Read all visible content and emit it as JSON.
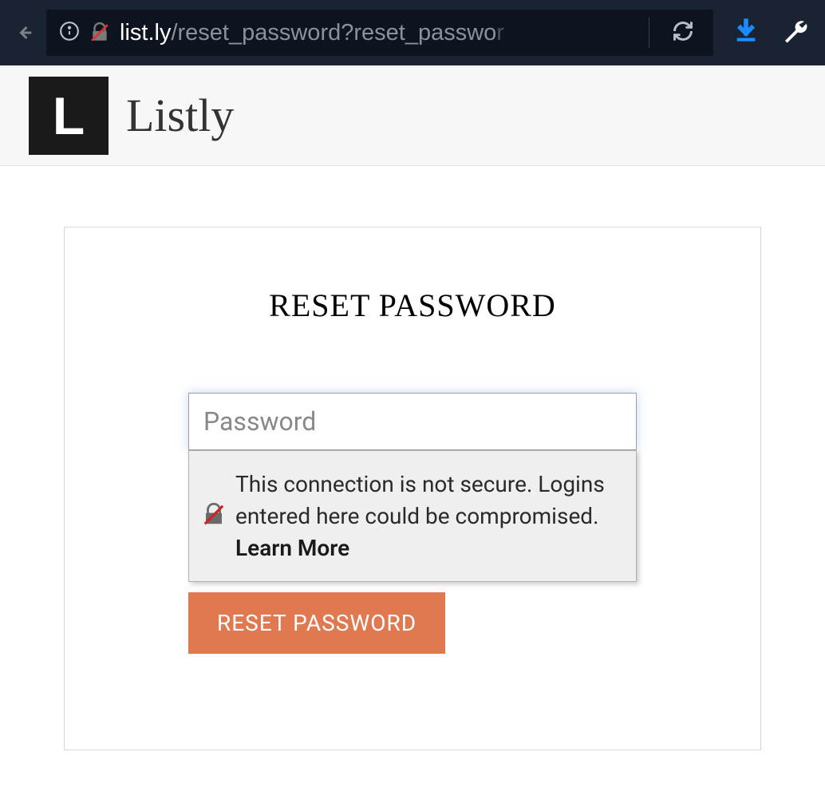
{
  "browser": {
    "url_domain": "list.ly",
    "url_path": "/reset_password?reset_passwo",
    "url_fade": "r"
  },
  "header": {
    "logo_letter": "L",
    "logo_text": "Listly"
  },
  "form": {
    "title": "RESET PASSWORD",
    "password_placeholder": "Password",
    "submit_label": "RESET PASSWORD"
  },
  "tooltip": {
    "message": "This connection is not secure. Logins entered here could be compromised. ",
    "link": "Learn More"
  }
}
